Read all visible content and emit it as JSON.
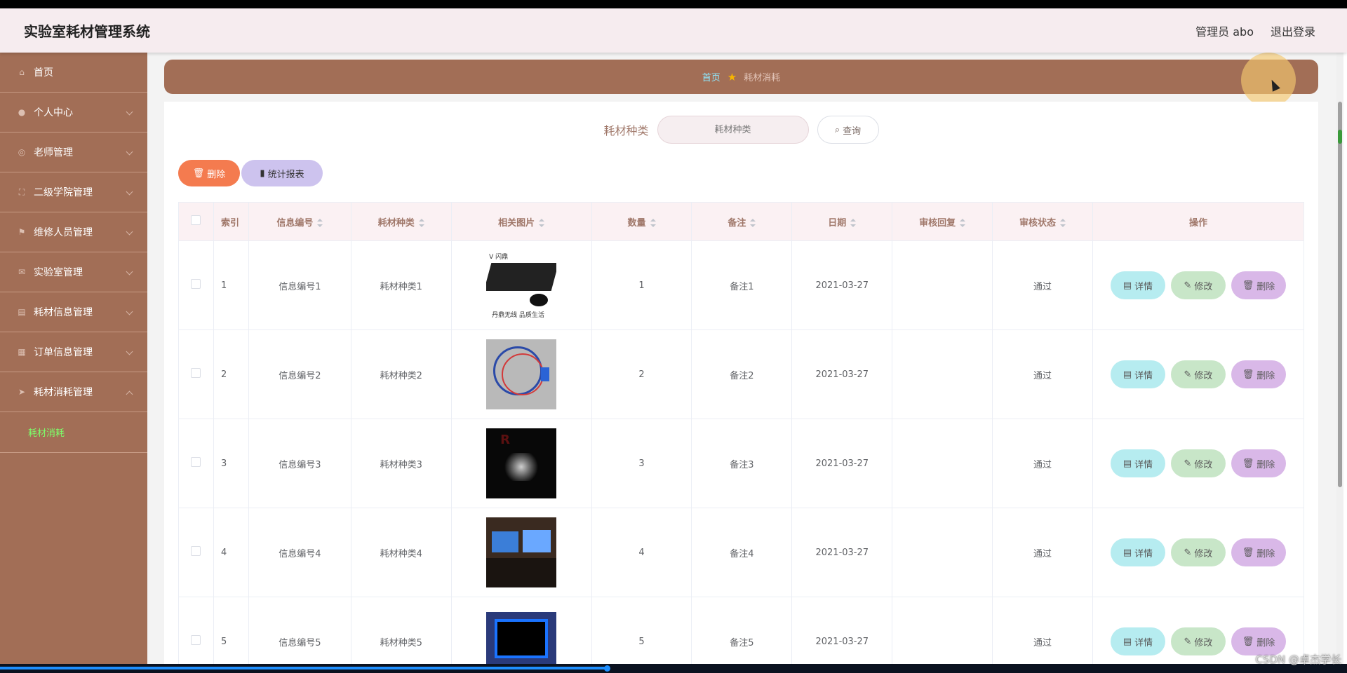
{
  "header": {
    "title": "实验室耗材管理系统",
    "user": "管理员 abo",
    "logout": "退出登录"
  },
  "sidebar": {
    "items": [
      {
        "label": "首页",
        "icon": "home-icon"
      },
      {
        "label": "个人中心",
        "icon": "user-icon"
      },
      {
        "label": "老师管理",
        "icon": "teacher-icon"
      },
      {
        "label": "二级学院管理",
        "icon": "frame-icon"
      },
      {
        "label": "维修人员管理",
        "icon": "flag-icon"
      },
      {
        "label": "实验室管理",
        "icon": "mail-icon"
      },
      {
        "label": "耗材信息管理",
        "icon": "clipboard-icon"
      },
      {
        "label": "订单信息管理",
        "icon": "grid-icon"
      },
      {
        "label": "耗材消耗管理",
        "icon": "send-icon"
      }
    ],
    "sub_item": "耗材消耗"
  },
  "breadcrumb": {
    "home": "首页",
    "current": "耗材消耗"
  },
  "search": {
    "label": "耗材种类",
    "placeholder": "耗材种类",
    "button": "查询"
  },
  "actions": {
    "delete": "删除",
    "report": "统计报表"
  },
  "table": {
    "headers": {
      "index": "索引",
      "code": "信息编号",
      "type": "耗材种类",
      "image": "相关图片",
      "quantity": "数量",
      "remark": "备注",
      "date": "日期",
      "reply": "审核回复",
      "status": "审核状态",
      "ops": "操作"
    },
    "rows": [
      {
        "index": "1",
        "code": "信息编号1",
        "type": "耗材种类1",
        "quantity": "1",
        "remark": "备注1",
        "date": "2021-03-27",
        "reply": "",
        "status": "通过"
      },
      {
        "index": "2",
        "code": "信息编号2",
        "type": "耗材种类2",
        "quantity": "2",
        "remark": "备注2",
        "date": "2021-03-27",
        "reply": "",
        "status": "通过"
      },
      {
        "index": "3",
        "code": "信息编号3",
        "type": "耗材种类3",
        "quantity": "3",
        "remark": "备注3",
        "date": "2021-03-27",
        "reply": "",
        "status": "通过"
      },
      {
        "index": "4",
        "code": "信息编号4",
        "type": "耗材种类4",
        "quantity": "4",
        "remark": "备注4",
        "date": "2021-03-27",
        "reply": "",
        "status": "通过"
      },
      {
        "index": "5",
        "code": "信息编号5",
        "type": "耗材种类5",
        "quantity": "5",
        "remark": "备注5",
        "date": "2021-03-27",
        "reply": "",
        "status": "通过"
      }
    ],
    "op_labels": {
      "detail": "详情",
      "edit": "修改",
      "delete": "删除"
    }
  },
  "images": {
    "img1_logo": "V 闪鼎",
    "img1_caption": "丹鼎无线 品质生活",
    "img3_text": "R"
  },
  "watermark": "CSDN @卓杰学长",
  "colors": {
    "sidebar": "#a26e56",
    "header": "#f6ecef",
    "accent_green": "#7dff6a",
    "delete_orange": "#f47b4f"
  }
}
